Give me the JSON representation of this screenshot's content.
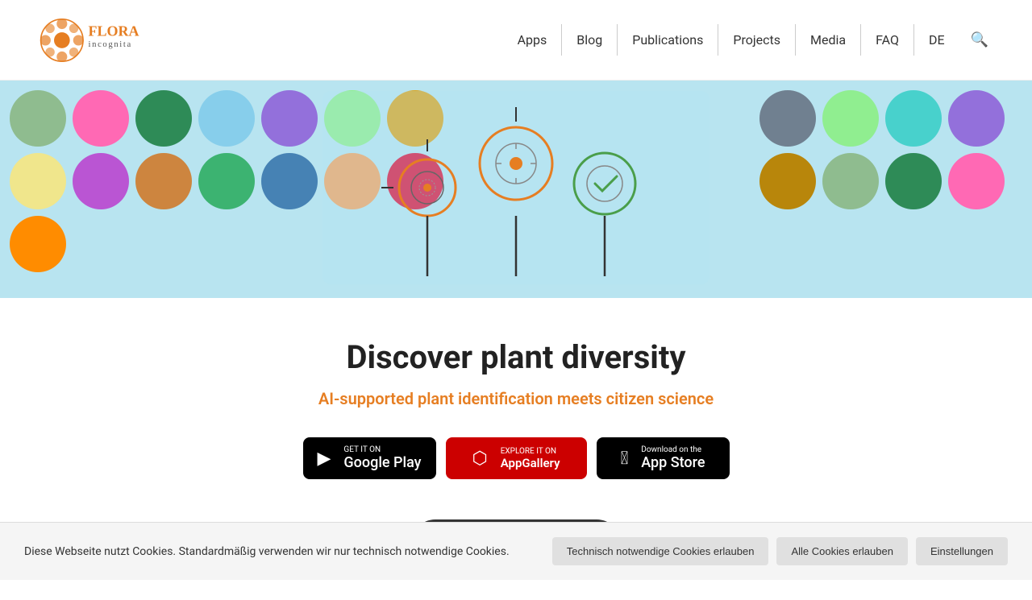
{
  "header": {
    "logo_alt": "Flora Incognita",
    "nav_items": [
      {
        "label": "Apps",
        "id": "nav-apps"
      },
      {
        "label": "Blog",
        "id": "nav-blog"
      },
      {
        "label": "Publications",
        "id": "nav-publications"
      },
      {
        "label": "Projects",
        "id": "nav-projects"
      },
      {
        "label": "Media",
        "id": "nav-media"
      },
      {
        "label": "FAQ",
        "id": "nav-faq"
      },
      {
        "label": "DE",
        "id": "nav-de"
      }
    ]
  },
  "hero": {
    "title": "Discover plant diversity",
    "subtitle": "AI-supported plant identification meets citizen science"
  },
  "store_buttons": {
    "google_play": {
      "top_text": "GET IT ON",
      "main_text": "Google Play"
    },
    "huawei": {
      "top_text": "EXPLORE IT ON",
      "main_text": "AppGallery"
    },
    "app_store": {
      "top_text": "Download on the",
      "main_text": "App Store"
    }
  },
  "cookie": {
    "text": "Diese Webseite nutzt Cookies. Standardmäßig verwenden wir nur technisch notwendige Cookies.",
    "btn_necessary": "Technisch notwendige Cookies erlauben",
    "btn_all": "Alle Cookies erlauben",
    "btn_settings": "Einstellungen"
  },
  "circles": [
    "c1",
    "c6",
    "c2",
    "c11",
    "c5",
    "c3",
    "c7",
    "c4",
    "c8",
    "c13",
    "c9",
    "c14",
    "c10",
    "c15",
    "c16",
    "c17",
    "c12",
    "c18",
    "c3",
    "c6",
    "c1",
    "c7",
    "c2",
    "c8",
    "c11",
    "c5",
    "c4",
    "c9",
    "c10",
    "c13",
    "c14",
    "c15",
    "c16",
    "c17",
    "c12",
    "c18"
  ]
}
